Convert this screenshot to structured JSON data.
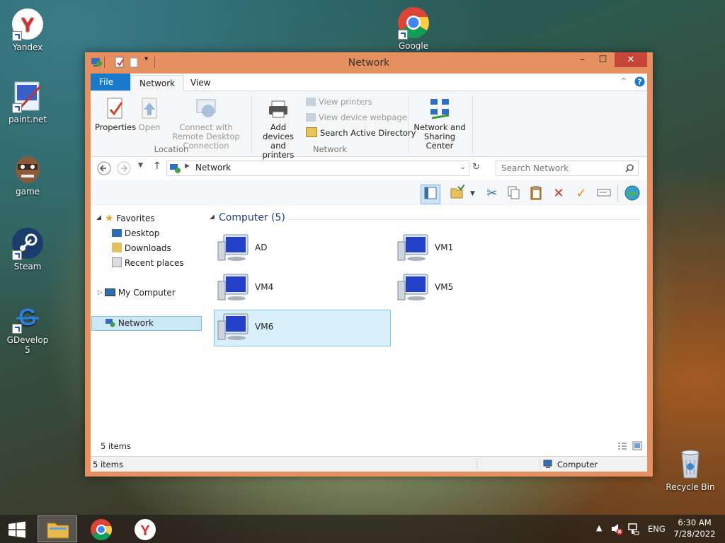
{
  "desktop": {
    "icons": [
      {
        "label": "Yandex",
        "icon": "yandex-icon"
      },
      {
        "label": "Google",
        "icon": "chrome-icon"
      },
      {
        "label": "paint.net",
        "icon": "paintnet-icon"
      },
      {
        "label": "game",
        "icon": "game-icon"
      },
      {
        "label": "Steam",
        "icon": "steam-icon"
      },
      {
        "label": "GDevelop 5",
        "icon": "gdevelop-icon"
      },
      {
        "label": "Recycle Bin",
        "icon": "recycle-bin-icon"
      }
    ]
  },
  "window": {
    "title": "Network",
    "controls": {
      "minimize": "–",
      "maximize": "☐",
      "close": "✕"
    },
    "tabs": {
      "file": "File",
      "network": "Network",
      "view": "View"
    },
    "ribbon": {
      "properties": "Properties",
      "open": "Open",
      "connect_remote": "Connect with Remote Desktop Connection",
      "location_group": "Location",
      "add_devices": "Add devices and printers",
      "view_printers": "View printers",
      "view_device_webpage": "View device webpage",
      "search_ad": "Search Active Directory",
      "network_group": "Network",
      "network_sharing": "Network and Sharing Center"
    },
    "address": {
      "path": "Network",
      "search_placeholder": "Search Network"
    },
    "nav": {
      "favorites": "Favorites",
      "desktop": "Desktop",
      "downloads": "Downloads",
      "recent_places": "Recent places",
      "my_computer": "My Computer",
      "network": "Network"
    },
    "content": {
      "group_header": "Computer (5)",
      "items": [
        {
          "label": "AD"
        },
        {
          "label": "VM1"
        },
        {
          "label": "VM4"
        },
        {
          "label": "VM5"
        },
        {
          "label": "VM6"
        }
      ],
      "selected": "VM6"
    },
    "status": {
      "inner_count": "5 items",
      "bar_count": "5 items",
      "bar_location": "Computer"
    }
  },
  "taskbar": {
    "language": "ENG",
    "time": "6:30 AM",
    "date": "7/28/2022"
  }
}
